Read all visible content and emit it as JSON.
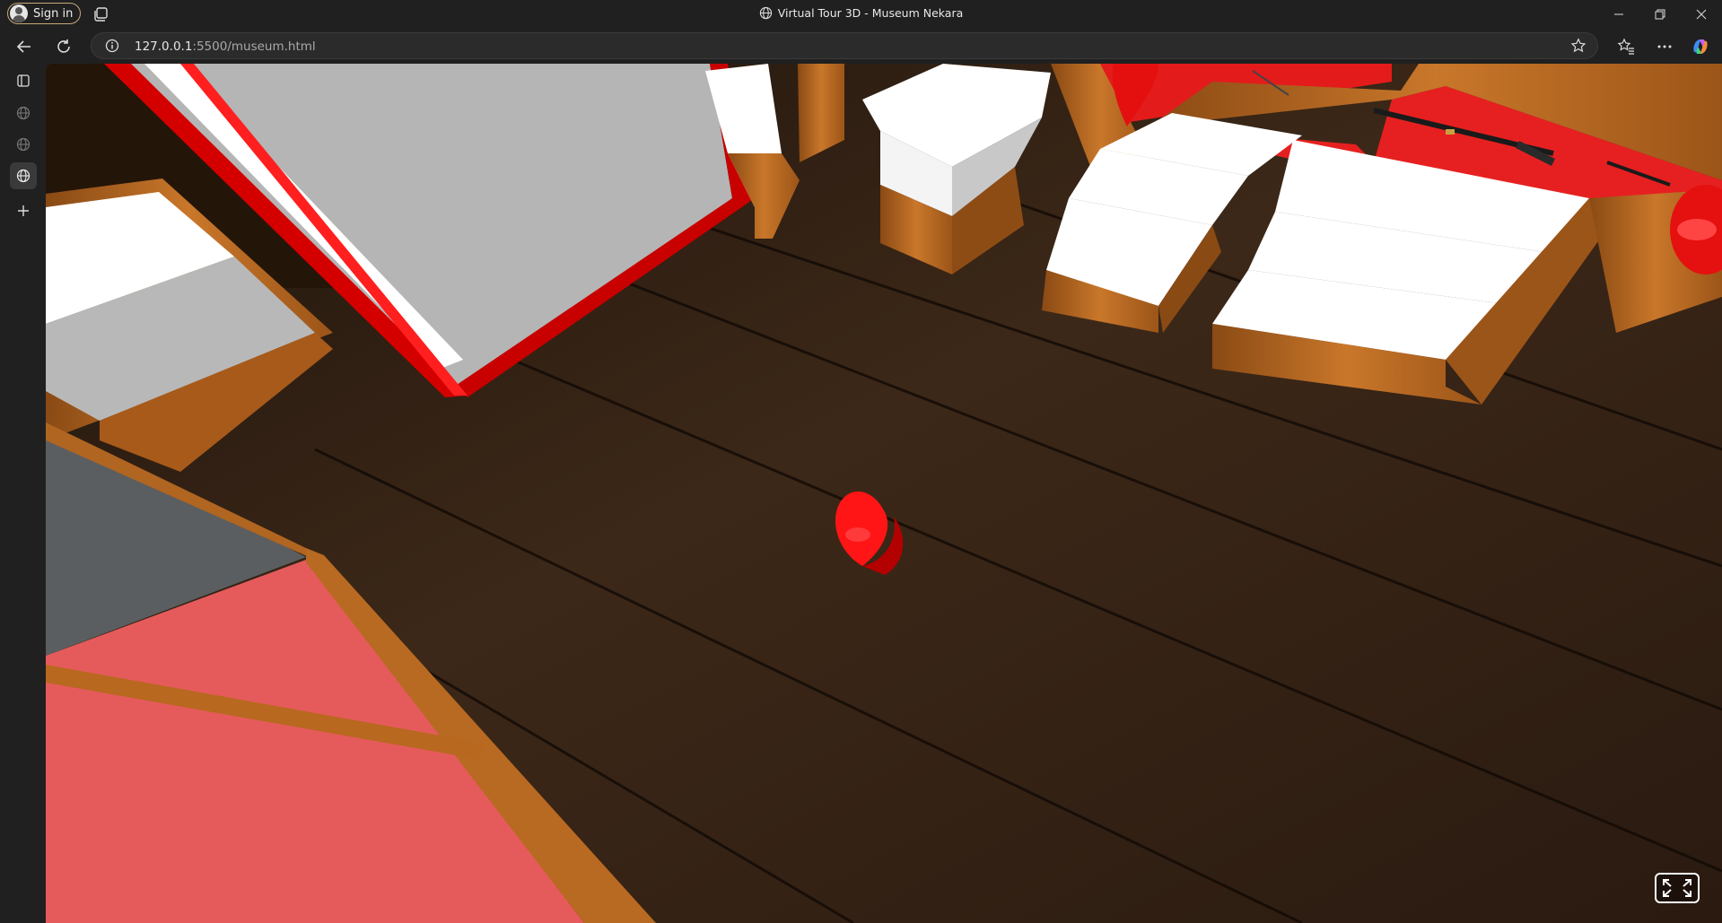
{
  "titlebar": {
    "signin_label": "Sign in",
    "page_title": "Virtual Tour 3D - Museum Nekara"
  },
  "toolbar": {
    "url_host": "127.0.0.1",
    "url_path": ":5500/museum.html"
  },
  "sidebar": {
    "items": [
      {
        "icon": "sidebar-panel-icon"
      },
      {
        "icon": "globe-icon"
      },
      {
        "icon": "globe-icon"
      },
      {
        "icon": "globe-icon",
        "active": true
      },
      {
        "icon": "plus-icon"
      }
    ]
  },
  "scene": {
    "colors": {
      "floor": "#3a2617",
      "wood": "#b8661e",
      "red_frame": "#c40000",
      "marker": "#ff1a1a",
      "pink_floor": "#e55b5b",
      "display_top": "#ffffff",
      "panel_grey": "#b8b8b8"
    }
  }
}
